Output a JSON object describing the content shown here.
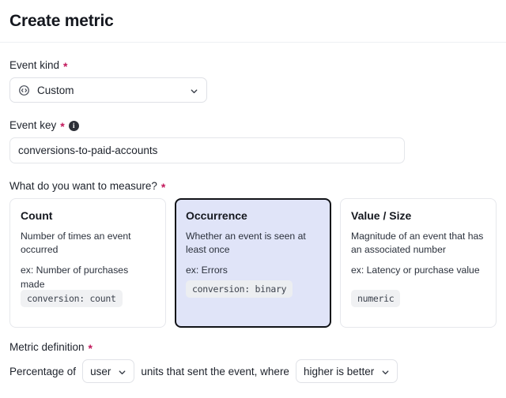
{
  "header": {
    "title": "Create metric"
  },
  "event_kind": {
    "label": "Event kind",
    "required_mark": "*",
    "icon": "code-circle-icon",
    "value": "Custom",
    "chevron": "chevron-down-icon"
  },
  "event_key": {
    "label": "Event key",
    "required_mark": "*",
    "info_icon": "info-icon",
    "info_glyph": "i",
    "value": "conversions-to-paid-accounts",
    "placeholder": "conversions-to-paid-accounts"
  },
  "measure": {
    "label": "What do you want to measure?",
    "required_mark": "*",
    "options": [
      {
        "title": "Count",
        "description": "Number of times an event occurred",
        "example": "ex: Number of purchases made",
        "chip": "conversion: count",
        "selected": false
      },
      {
        "title": "Occurrence",
        "description": "Whether an event is seen at least once",
        "example": "ex: Errors",
        "chip": "conversion: binary",
        "selected": true
      },
      {
        "title": "Value / Size",
        "description": "Magnitude of an event that has an associated number",
        "example": "ex: Latency or purchase value",
        "chip": "numeric",
        "selected": false
      }
    ]
  },
  "metric_definition": {
    "label": "Metric definition",
    "required_mark": "*",
    "prefix_text": "Percentage of",
    "unit_select": {
      "value": "user",
      "chevron": "chevron-down-icon"
    },
    "middle_text": "units that sent the event, where",
    "direction_select": {
      "value": "higher is better",
      "chevron": "chevron-down-icon"
    }
  },
  "colors": {
    "selected_card_bg": "#e0e4f8",
    "selected_card_border": "#111317",
    "required_asterisk": "#c2185b",
    "chip_bg": "#f0f1f3",
    "border": "#e6e8ec"
  }
}
